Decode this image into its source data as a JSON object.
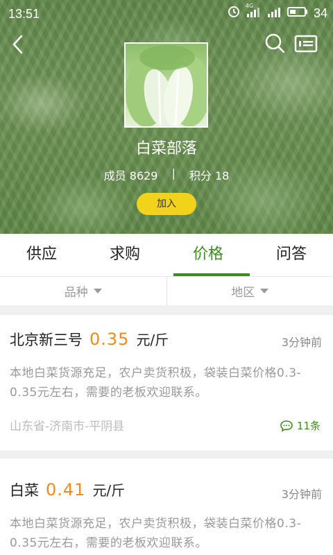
{
  "status_bar": {
    "time": "13:51",
    "battery": "34",
    "network": "4G"
  },
  "group": {
    "name": "白菜部落",
    "members_label": "成员 8629",
    "separator": "|",
    "points_label": "积分 18",
    "join_label": "加入"
  },
  "tabs": [
    {
      "label": "供应",
      "active": false
    },
    {
      "label": "求购",
      "active": false
    },
    {
      "label": "价格",
      "active": true
    },
    {
      "label": "问答",
      "active": false
    }
  ],
  "filters": [
    {
      "label": "品种"
    },
    {
      "label": "地区"
    }
  ],
  "posts": [
    {
      "name": "北京新三号",
      "price": "0.35",
      "unit": "元/斤",
      "time": "3分钟前",
      "body": "本地白菜货源充足，农户卖货积极，袋装白菜价格0.3-0.35元左右，需要的老板欢迎联系。",
      "location": "山东省-济南市-平阴县",
      "comments": "11条"
    },
    {
      "name": "白菜",
      "price": "0.41",
      "unit": "元/斤",
      "time": "3分钟前",
      "body": "本地白菜货源充足，农户卖货积极，袋装白菜价格0.3-0.35元左右，需要的老板欢迎联系。"
    }
  ],
  "colors": {
    "accent_green": "#3d8c1f",
    "price_orange": "#f08a1c",
    "join_yellow": "#f2d31c"
  }
}
